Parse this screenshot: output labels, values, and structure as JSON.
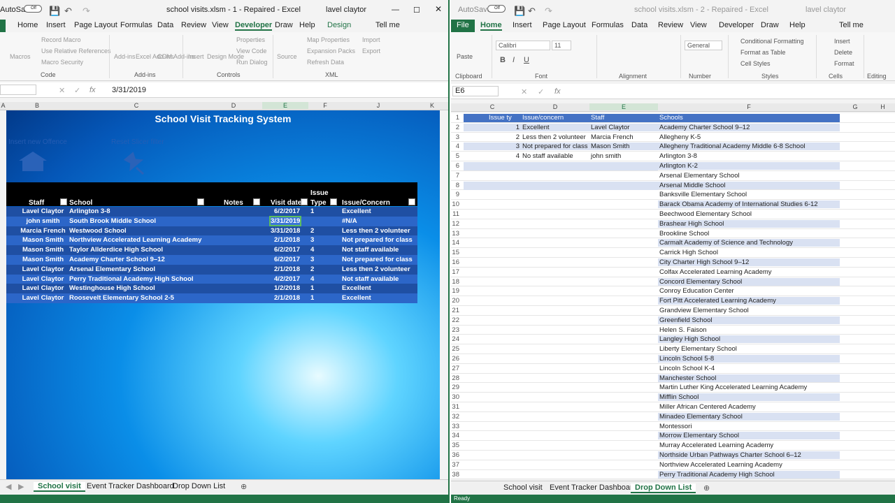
{
  "left": {
    "autosave": "AutoSave",
    "toggle": "Off",
    "file_title": "school visits.xlsm  -  1  -  Repaired  -  Excel",
    "user": "lavel claytor",
    "tabs": [
      "Home",
      "Insert",
      "Page Layout",
      "Formulas",
      "Data",
      "Review",
      "View",
      "Developer",
      "Draw",
      "Help",
      "Design",
      "Tell me"
    ],
    "ribbon": {
      "record": "Record Macro",
      "relative": "Use Relative References",
      "security": "Macro Security",
      "macros": "Macros",
      "addins": "Add-ins",
      "excel_addins": "Excel Add-ins",
      "com_addins": "COM Add-ins",
      "insert": "Insert",
      "design_mode": "Design Mode",
      "properties": "Properties",
      "view_code": "View Code",
      "run_dialog": "Run Dialog",
      "source": "Source",
      "map_props": "Map Properties",
      "expansion": "Expansion Packs",
      "refresh": "Refresh Data",
      "import": "Import",
      "export": "Export",
      "g_code": "Code",
      "g_addins": "Add-ins",
      "g_controls": "Controls",
      "g_xml": "XML"
    },
    "namebox": "",
    "formula": "3/31/2019",
    "cols": [
      "A",
      "B",
      "C",
      "D",
      "E",
      "F",
      "J",
      "K"
    ],
    "sheet_title": "School Visit Tracking System",
    "slicer1": "Insert new Offence",
    "slicer2": "Reset Slicer filter",
    "headers": {
      "staff": "Staff",
      "school": "School",
      "notes": "Notes",
      "visit_date": "Visit date",
      "issue_type_1": "Issue",
      "issue_type_2": "Type",
      "issue": "Issue/Concern"
    },
    "rows": [
      {
        "staff": "Lavel Claytor",
        "school": "Arlington 3-8",
        "date": "6/2/2017",
        "type": "1",
        "issue": "Excellent"
      },
      {
        "staff": "john smith",
        "school": "South Brook Middle School",
        "date": "3/31/2019",
        "type": "",
        "issue": "#N/A"
      },
      {
        "staff": "Marcia French",
        "school": "Westwood School",
        "date": "3/31/2018",
        "type": "2",
        "issue": "Less then 2 volunteer"
      },
      {
        "staff": "Mason Smith",
        "school": "Northview Accelerated Learning Academy",
        "date": "2/1/2018",
        "type": "3",
        "issue": "Not prepared for class"
      },
      {
        "staff": "Mason Smith",
        "school": "Taylor Allderdice High School",
        "date": "6/2/2017",
        "type": "4",
        "issue": "Not staff available"
      },
      {
        "staff": "Mason Smith",
        "school": "Academy Charter School 9–12",
        "date": "6/2/2017",
        "type": "3",
        "issue": "Not prepared for class"
      },
      {
        "staff": "Lavel Claytor",
        "school": "Arsenal Elementary School",
        "date": "2/1/2018",
        "type": "2",
        "issue": "Less then 2 volunteer"
      },
      {
        "staff": "Lavel Claytor",
        "school": "Perry Traditional Academy High School",
        "date": "4/2/2017",
        "type": "4",
        "issue": "Not staff available"
      },
      {
        "staff": "Lavel Claytor",
        "school": "Westinghouse High School",
        "date": "1/2/2018",
        "type": "1",
        "issue": "Excellent"
      },
      {
        "staff": "Lavel Claytor",
        "school": "Roosevelt Elementary School 2-5",
        "date": "2/1/2018",
        "type": "1",
        "issue": "Excellent"
      }
    ],
    "sheets": [
      "School visit",
      "Event Tracker Dashboard",
      "Drop Down List"
    ]
  },
  "right": {
    "autosave": "AutoSave",
    "toggle": "Off",
    "file_title": "school visits.xlsm  -  2  -  Repaired  -  Excel",
    "user": "lavel claytor",
    "tabs": [
      "File",
      "Home",
      "Insert",
      "Page Layout",
      "Formulas",
      "Data",
      "Review",
      "View",
      "Developer",
      "Draw",
      "Help",
      "Tell me"
    ],
    "ribbon": {
      "paste": "Paste",
      "font": "Calibri",
      "size": "11",
      "fmt": "General",
      "cond": "Conditional Formatting",
      "fmt_table": "Format as Table",
      "cell_styles": "Cell Styles",
      "insert": "Insert",
      "delete": "Delete",
      "format": "Format",
      "g_clip": "Clipboard",
      "g_font": "Font",
      "g_align": "Alignment",
      "g_num": "Number",
      "g_styles": "Styles",
      "g_cells": "Cells",
      "g_edit": "Editing"
    },
    "namebox": "E6",
    "cols": [
      "C",
      "D",
      "E",
      "F",
      "G",
      "H"
    ],
    "headers": {
      "issue_type": "Issue ty",
      "issue": "Issue/concern",
      "staff": "Staff",
      "schools": "Schools"
    },
    "issues": [
      [
        "1",
        "Excellent"
      ],
      [
        "2",
        "Less then 2 volunteer"
      ],
      [
        "3",
        "Not prepared for class"
      ],
      [
        "4",
        "No staff available"
      ]
    ],
    "staff": [
      "Lavel Claytor",
      "Marcia French",
      "Mason Smith",
      "john smith"
    ],
    "schools": [
      "Academy Charter School 9–12",
      "Allegheny K-5",
      "Allegheny Traditional Academy Middle 6-8 School",
      "Arlington 3-8",
      "Arlington K-2",
      "Arsenal Elementary School",
      "Arsenal Middle School",
      "Banksville Elementary School",
      "Barack Obama Academy of International Studies 6-12",
      "Beechwood Elementary School",
      "Brashear High School",
      "Brookline School",
      "Carmalt Academy of Science and Technology",
      "Carrick High School",
      "City Charter High School 9–12",
      "Colfax Accelerated Learning Academy",
      "Concord Elementary School",
      "Conroy Education Center",
      "Fort Pitt Accelerated Learning Academy",
      "Grandview Elementary School",
      "Greenfield School",
      "Helen S. Faison",
      "Langley High School",
      "Liberty Elementary School",
      "Lincoln School 5-8",
      "Lincoln School K-4",
      "Manchester School",
      "Martin Luther King Accelerated Learning Academy",
      "Mifflin School",
      "Miller African Centered Academy",
      "Minadeo Elementary School",
      "Montessori",
      "Morrow Elementary School",
      "Murray Accelerated Learning Academy",
      "Northside Urban Pathways Charter School 6–12",
      "Northview Accelerated Learning Academy",
      "Perry Traditional Academy High School"
    ],
    "sheets": [
      "School visit",
      "Event Tracker Dashboard",
      "Drop Down List"
    ],
    "status": "Ready"
  }
}
